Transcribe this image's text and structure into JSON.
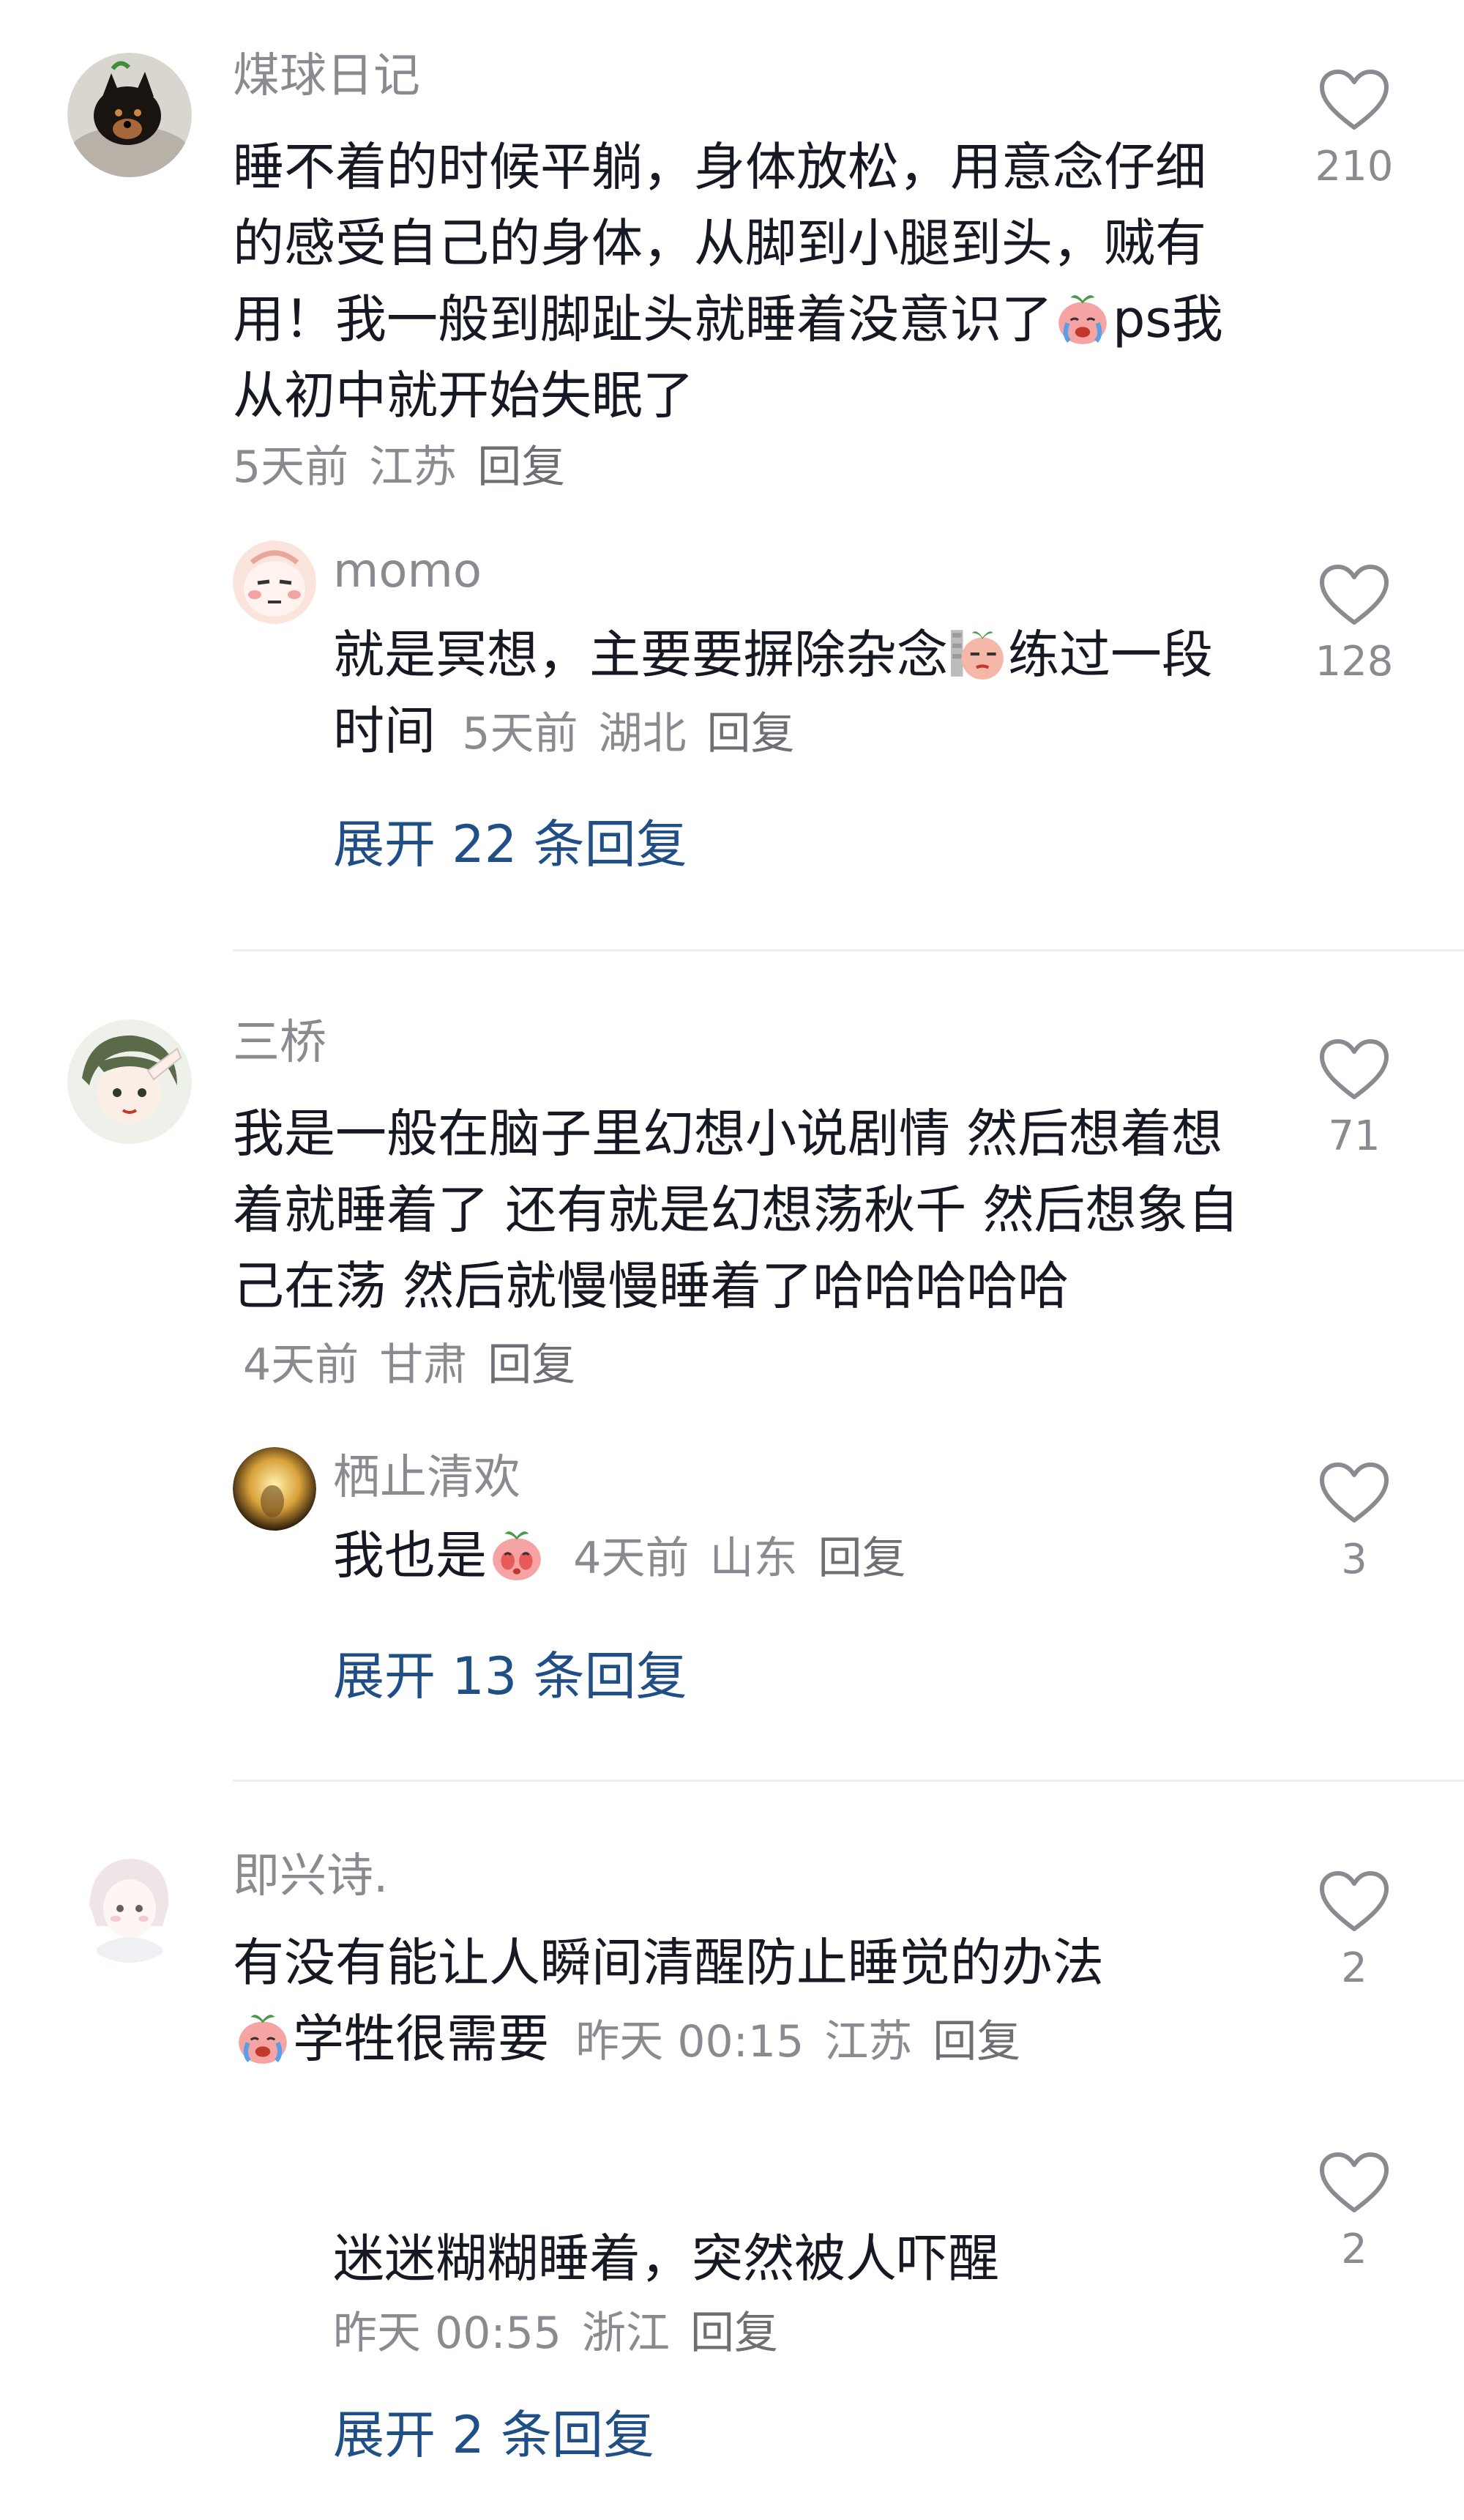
{
  "comments": [
    {
      "username": "煤球日记",
      "text_before_emoji": "睡不着的时候平躺，身体放松，用意念仔细的感受自己的身体，从脚到小腿到头，贼有用！我一般到脚趾头就睡着没意识了",
      "text_after_emoji": "ps我从初中就开始失眠了",
      "time": "5天前",
      "location": "江苏",
      "reply_label": "回复",
      "likes": "210",
      "reply": {
        "username": "momo",
        "text_before_emoji": "就是冥想，主要要摒除杂念",
        "text_after_emoji": "练过一段时间",
        "time": "5天前",
        "location": "湖北",
        "reply_label": "回复",
        "likes": "128"
      },
      "expand_label": "展开 22 条回复"
    },
    {
      "username": "三桥",
      "text": "我是一般在脑子里幻想小说剧情 然后想着想着就睡着了 还有就是幻想荡秋千 然后想象自己在荡 然后就慢慢睡着了哈哈哈哈哈",
      "time": "4天前",
      "location": "甘肃",
      "reply_label": "回复",
      "likes": "71",
      "reply": {
        "username": "栖止清欢",
        "text": "我也是",
        "time": "4天前",
        "location": "山东",
        "reply_label": "回复",
        "likes": "3"
      },
      "expand_label": "展开 13 条回复"
    },
    {
      "username": "即兴诗.",
      "text_line1": "有没有能让人瞬间清醒防止睡觉的办法",
      "text_line2": "学牲很需要",
      "time": "昨天 00:15",
      "location": "江苏",
      "reply_label": "回复",
      "likes": "2",
      "reply": {
        "text": "迷迷糊糊睡着，突然被人吓醒",
        "time": "昨天 00:55",
        "location": "浙江",
        "reply_label": "回复",
        "likes": "2"
      },
      "expand_label": "展开 2 条回复"
    }
  ],
  "icons": {
    "like": "heart-outline-icon",
    "emoji_cry": "crying-peach-emoji-icon",
    "emoji_smirk": "smirk-peach-emoji-icon",
    "emoji_shy": "shy-peach-emoji-icon"
  },
  "colors": {
    "text": "#161823",
    "secondary": "#8a8b91",
    "link": "#1f4f86",
    "divider": "#eeeeee"
  }
}
